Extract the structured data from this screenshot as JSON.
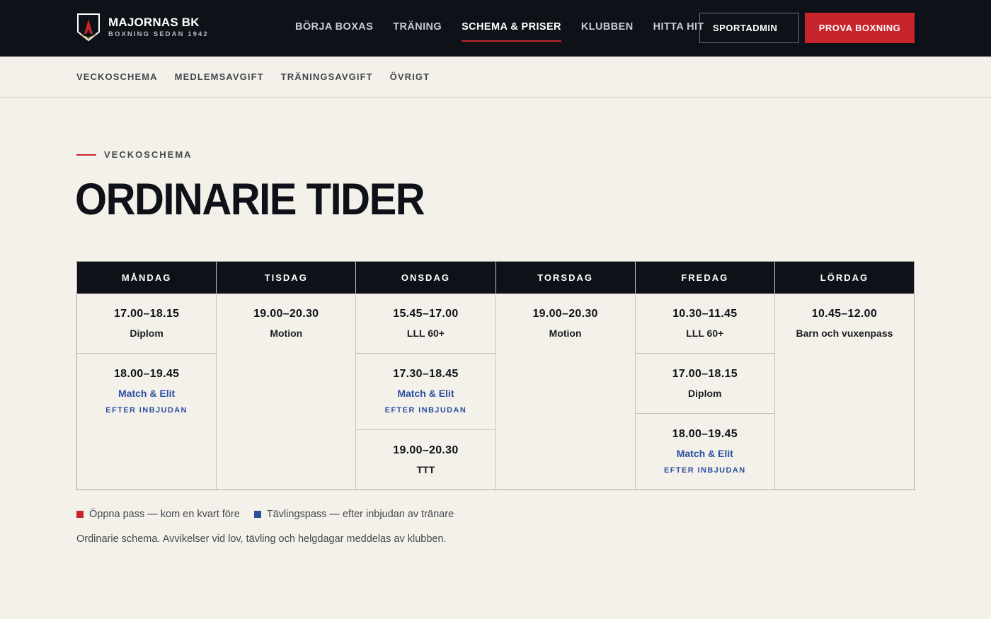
{
  "brand": {
    "name": "MAJORNAS BK",
    "tagline": "BOXNING SEDAN 1942",
    "colors": {
      "dark": "#0e1117",
      "red": "#c8242c",
      "gold": "#d9b45a",
      "blue": "#2a4f9e"
    }
  },
  "nav": {
    "items": [
      {
        "label": "BÖRJA BOXAS",
        "active": false
      },
      {
        "label": "TRÄNING",
        "active": false
      },
      {
        "label": "SCHEMA & PRISER",
        "active": true
      },
      {
        "label": "KLUBBEN",
        "active": false
      },
      {
        "label": "HITTA HIT",
        "active": false
      }
    ],
    "sportadmin_label": "SPORTADMIN",
    "cta_label": "PROVA BOXNING"
  },
  "subnav": {
    "items": [
      "VECKOSCHEMA",
      "MEDLEMSAVGIFT",
      "TRÄNINGSAVGIFT",
      "ÖVRIGT"
    ]
  },
  "section": {
    "eyebrow": "VECKOSCHEMA",
    "title": "ORDINARIE TIDER"
  },
  "schedule": {
    "days": [
      {
        "day": "MÅNDAG",
        "slots": [
          {
            "time": "17.00–18.15",
            "name": "Diplom"
          },
          {
            "time": "18.00–19.45",
            "name": "Match & Elit",
            "note": "EFTER INBJUDAN",
            "competition": true
          }
        ]
      },
      {
        "day": "TISDAG",
        "slots": [
          {
            "time": "19.00–20.30",
            "name": "Motion"
          }
        ]
      },
      {
        "day": "ONSDAG",
        "slots": [
          {
            "time": "15.45–17.00",
            "name": "LLL 60+"
          },
          {
            "time": "17.30–18.45",
            "name": "Match & Elit",
            "note": "EFTER INBJUDAN",
            "competition": true
          },
          {
            "time": "19.00–20.30",
            "name": "TTT"
          }
        ]
      },
      {
        "day": "TORSDAG",
        "slots": [
          {
            "time": "19.00–20.30",
            "name": "Motion"
          }
        ]
      },
      {
        "day": "FREDAG",
        "slots": [
          {
            "time": "10.30–11.45",
            "name": "LLL 60+"
          },
          {
            "time": "17.00–18.15",
            "name": "Diplom"
          },
          {
            "time": "18.00–19.45",
            "name": "Match & Elit",
            "note": "EFTER INBJUDAN",
            "competition": true
          }
        ]
      },
      {
        "day": "LÖRDAG",
        "slots": [
          {
            "time": "10.45–12.00",
            "name": "Barn och vuxenpass"
          }
        ]
      }
    ]
  },
  "legend": {
    "open": {
      "label": "Öppna pass — kom en kvart före",
      "color": "#c8242c"
    },
    "competition": {
      "label": "Tävlingspass — efter inbjudan av tränare",
      "color": "#2a4f9e"
    }
  },
  "footnote": "Ordinarie schema. Avvikelser vid lov, tävling och helgdagar meddelas av klubben."
}
